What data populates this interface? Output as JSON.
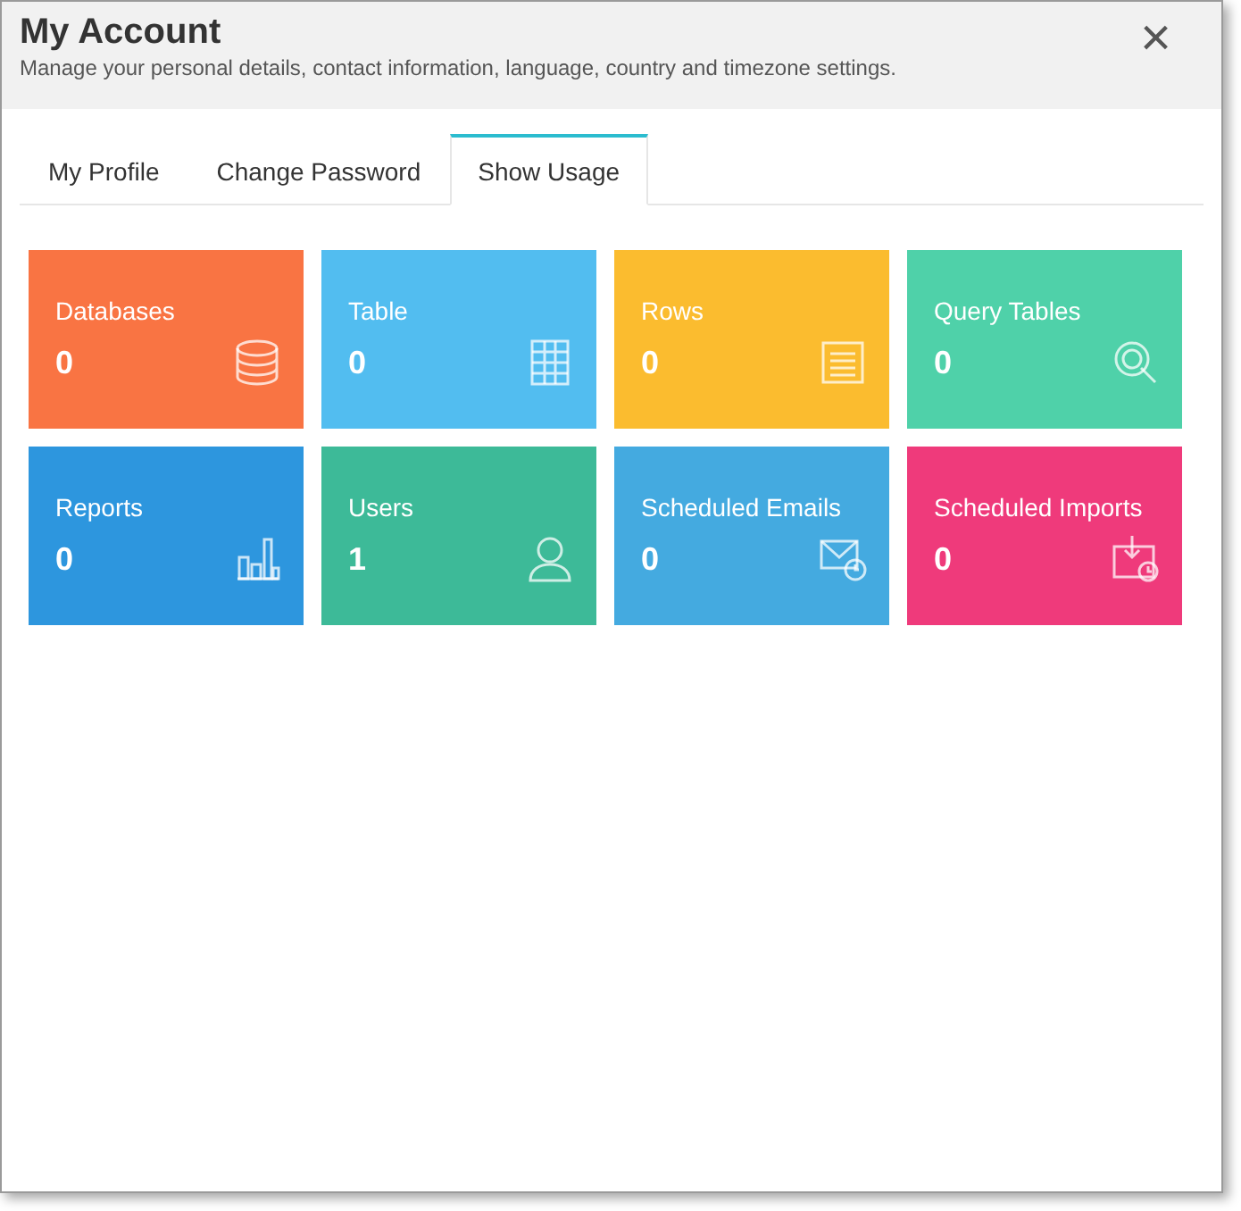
{
  "window": {
    "title": "My Account",
    "subtitle": "Manage your personal details, contact information, language, country and timezone settings.",
    "close": "×"
  },
  "tabs": [
    {
      "label": "My Profile",
      "selected": false
    },
    {
      "label": "Change Password",
      "selected": false
    },
    {
      "label": "Show Usage",
      "selected": true
    }
  ],
  "tiles": [
    {
      "label": "Databases",
      "value": "0",
      "color": "#f97443"
    },
    {
      "label": "Table",
      "value": "0",
      "color": "#52bdf0"
    },
    {
      "label": "Rows",
      "value": "0",
      "color": "#fbbc2f"
    },
    {
      "label": "Query Tables",
      "value": "0",
      "color": "#4fd1a9"
    },
    {
      "label": "Reports",
      "value": "0",
      "color": "#2d96de"
    },
    {
      "label": "Users",
      "value": "1",
      "color": "#3dba98"
    },
    {
      "label": "Scheduled Emails",
      "value": "0",
      "color": "#44aae0"
    },
    {
      "label": "Scheduled Imports",
      "value": "0",
      "color": "#ef3a7b"
    }
  ]
}
